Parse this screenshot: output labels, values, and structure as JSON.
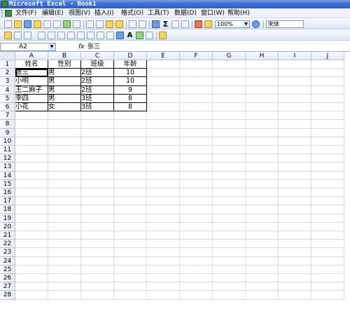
{
  "window": {
    "title": "Microsoft Excel - Book1"
  },
  "menus": [
    "文件(F)",
    "编辑(E)",
    "视图(V)",
    "插入(I)",
    "格式(O)",
    "工具(T)",
    "数据(D)",
    "窗口(W)",
    "帮助(H)"
  ],
  "toolbar": {
    "zoom": "100%",
    "font": "宋体",
    "text_button": "A"
  },
  "formula_bar": {
    "name_box": "A2",
    "fx_label": "fx",
    "value": "张三"
  },
  "columns": [
    "A",
    "B",
    "C",
    "D",
    "E",
    "F",
    "G",
    "H",
    "I",
    "J"
  ],
  "rows": [
    "1",
    "2",
    "3",
    "4",
    "5",
    "6",
    "7",
    "8",
    "9",
    "10",
    "11",
    "12",
    "13",
    "14",
    "15",
    "16",
    "17",
    "18",
    "19",
    "20",
    "21",
    "22",
    "23",
    "24",
    "25",
    "26",
    "27",
    "28"
  ],
  "table": {
    "headers": [
      "姓名",
      "性别",
      "班级",
      "年龄"
    ],
    "data": [
      [
        "张三",
        "男",
        "2班",
        "10"
      ],
      [
        "小明",
        "男",
        "2班",
        "10"
      ],
      [
        "王二麻子",
        "男",
        "2班",
        "9"
      ],
      [
        "李四",
        "男",
        "3班",
        "8"
      ],
      [
        "小花",
        "女",
        "3班",
        "8"
      ]
    ]
  },
  "colors": {
    "title_bar": "#3a6fd8",
    "menu_bg": "#eef3fb",
    "header_bg": "#e4e9f2"
  }
}
